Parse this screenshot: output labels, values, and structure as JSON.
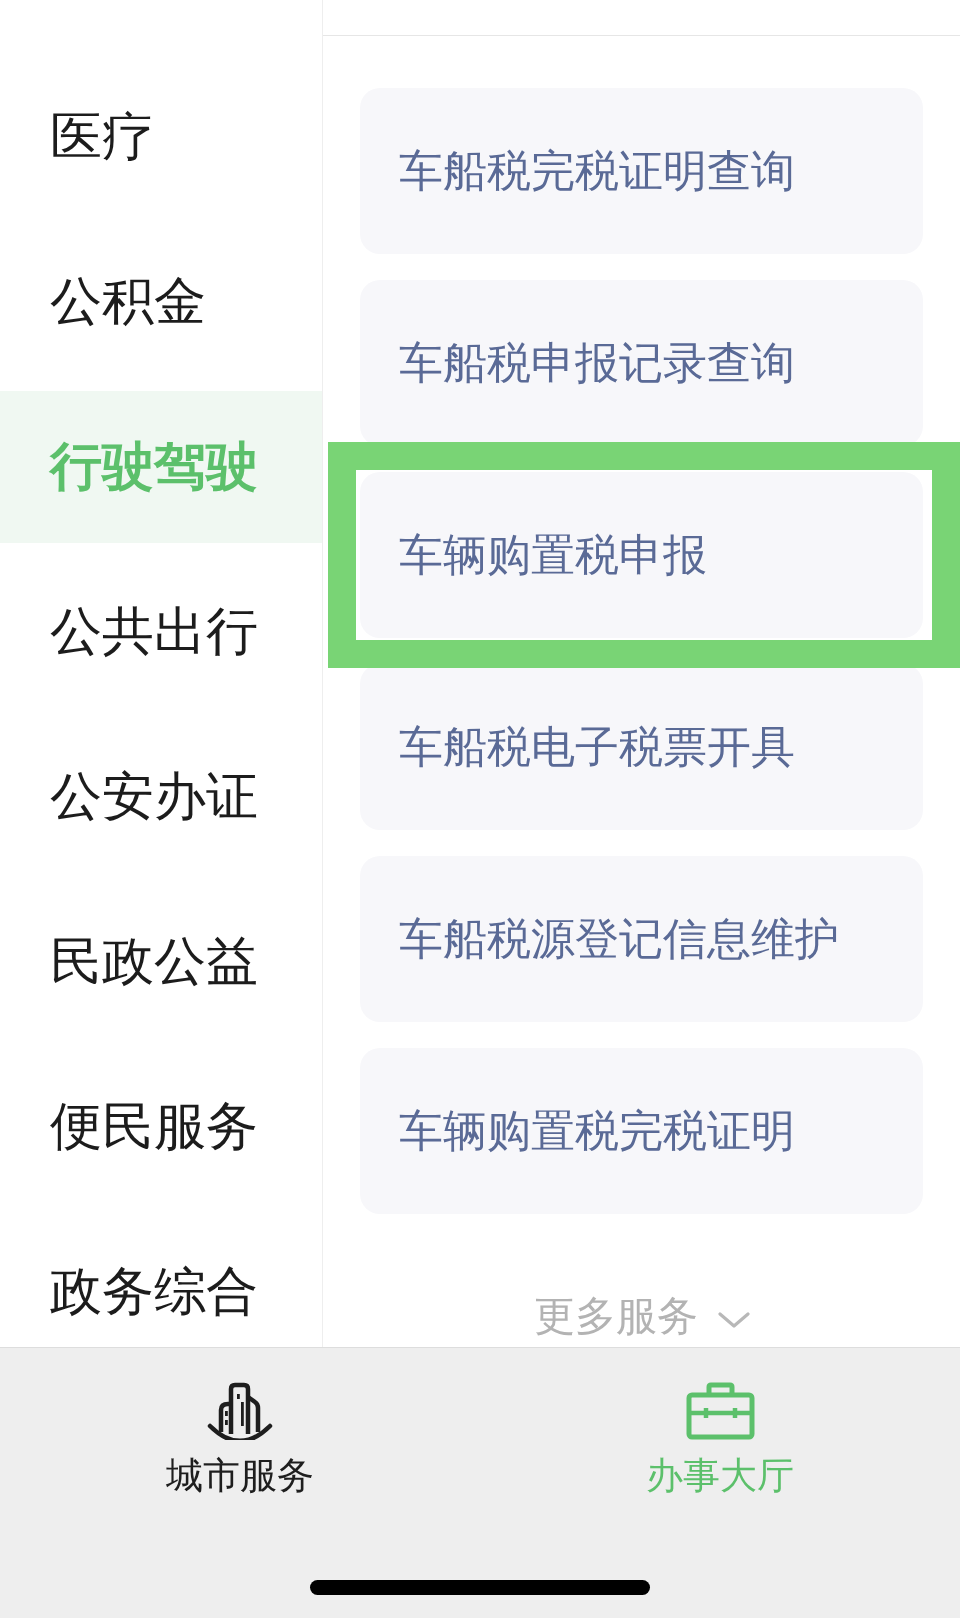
{
  "sidebar": {
    "items": [
      {
        "label": "医疗",
        "selected": false
      },
      {
        "label": "公积金",
        "selected": false
      },
      {
        "label": "行驶驾驶",
        "selected": true
      },
      {
        "label": "公共出行",
        "selected": false
      },
      {
        "label": "公安办证",
        "selected": false
      },
      {
        "label": "民政公益",
        "selected": false
      },
      {
        "label": "便民服务",
        "selected": false
      },
      {
        "label": "政务综合",
        "selected": false
      }
    ]
  },
  "services": {
    "items": [
      {
        "label": "车船税完税证明查询",
        "highlighted": false
      },
      {
        "label": "车船税申报记录查询",
        "highlighted": false
      },
      {
        "label": "车辆购置税申报",
        "highlighted": true
      },
      {
        "label": "车船税电子税票开具",
        "highlighted": false
      },
      {
        "label": "车船税源登记信息维护",
        "highlighted": false
      },
      {
        "label": "车辆购置税完税证明",
        "highlighted": false
      }
    ],
    "more": {
      "label": "更多服务"
    }
  },
  "tab_bar": {
    "tabs": [
      {
        "label": "城市服务",
        "selected": false
      },
      {
        "label": "办事大厅",
        "selected": true
      }
    ]
  }
}
